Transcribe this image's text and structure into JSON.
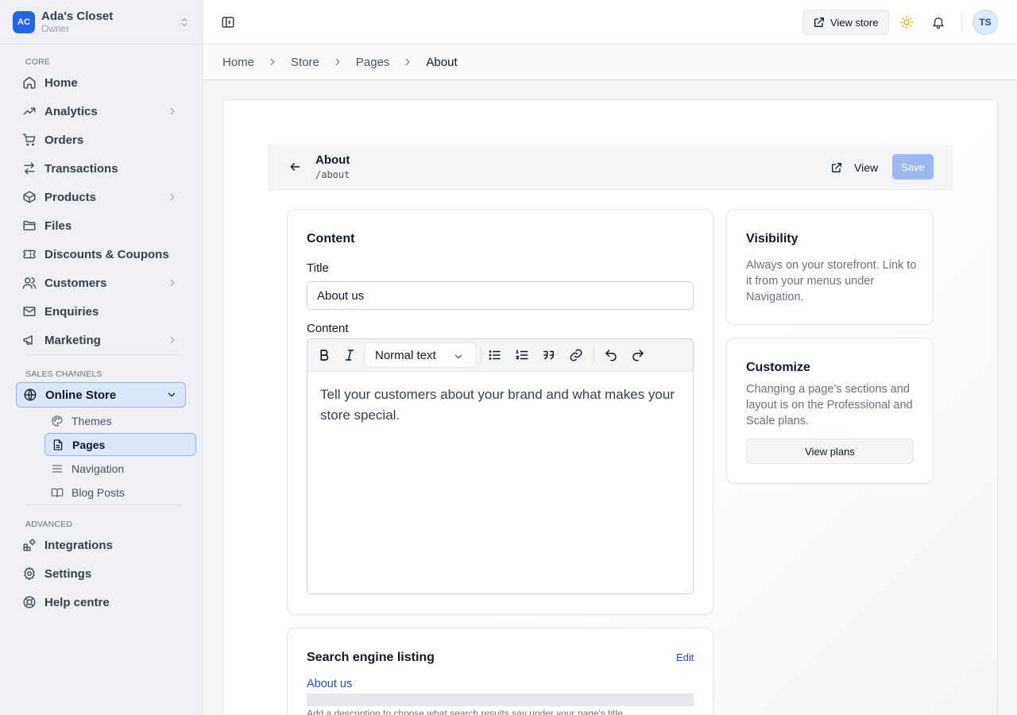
{
  "store": {
    "avatar_initials": "AC",
    "name": "Ada's Closet",
    "role": "Owner"
  },
  "sidebar": {
    "sections": {
      "core": "CORE",
      "sales": "SALES CHANNELS",
      "advanced": "ADVANCED"
    },
    "core_items": [
      {
        "label": "Home",
        "icon": "home-icon"
      },
      {
        "label": "Analytics",
        "icon": "trending-up-icon",
        "expandable": true
      },
      {
        "label": "Orders",
        "icon": "cart-icon"
      },
      {
        "label": "Transactions",
        "icon": "arrows-swap-icon"
      },
      {
        "label": "Products",
        "icon": "box-icon",
        "expandable": true
      },
      {
        "label": "Files",
        "icon": "folder-icon"
      },
      {
        "label": "Discounts & Coupons",
        "icon": "ticket-icon"
      },
      {
        "label": "Customers",
        "icon": "users-icon",
        "expandable": true
      },
      {
        "label": "Enquiries",
        "icon": "mail-icon"
      },
      {
        "label": "Marketing",
        "icon": "megaphone-icon",
        "expandable": true
      }
    ],
    "online_store": {
      "label": "Online Store",
      "icon": "globe-icon",
      "expanded": true
    },
    "store_sub_items": [
      {
        "label": "Themes",
        "icon": "palette-icon"
      },
      {
        "label": "Pages",
        "icon": "file-icon",
        "active": true
      },
      {
        "label": "Navigation",
        "icon": "menu-icon"
      },
      {
        "label": "Blog Posts",
        "icon": "book-icon"
      }
    ],
    "advanced_items": [
      {
        "label": "Integrations",
        "icon": "puzzle-icon"
      },
      {
        "label": "Settings",
        "icon": "gear-icon"
      },
      {
        "label": "Help centre",
        "icon": "lifebuoy-icon"
      }
    ]
  },
  "topbar": {
    "view_store": "View store",
    "user_initials": "TS"
  },
  "breadcrumb": [
    "Home",
    "Store",
    "Pages",
    "About"
  ],
  "page": {
    "title": "About",
    "slug": "/about",
    "view_label": "View",
    "save_label": "Save"
  },
  "content_card": {
    "heading": "Content",
    "title_label": "Title",
    "title_value": "About us",
    "content_label": "Content",
    "format_select": "Normal text",
    "body_text": "Tell your customers about your brand and what makes your store special."
  },
  "visibility_card": {
    "heading": "Visibility",
    "text": "Always on your storefront. Link to it from your menus under Navigation."
  },
  "customize_card": {
    "heading": "Customize",
    "text": "Changing a page's sections and layout is on the Professional and Scale plans.",
    "button": "View plans"
  },
  "seo_card": {
    "heading": "Search engine listing",
    "edit_label": "Edit",
    "listing_title": "About us",
    "description_hint": "Add a description to choose what search results say under your page's title."
  },
  "colors": {
    "accent": "#2563eb",
    "active_bg": "#dbe7fb",
    "save_disabled": "#9db8f3",
    "link": "#1d4ed8",
    "sun": "#eab308"
  }
}
